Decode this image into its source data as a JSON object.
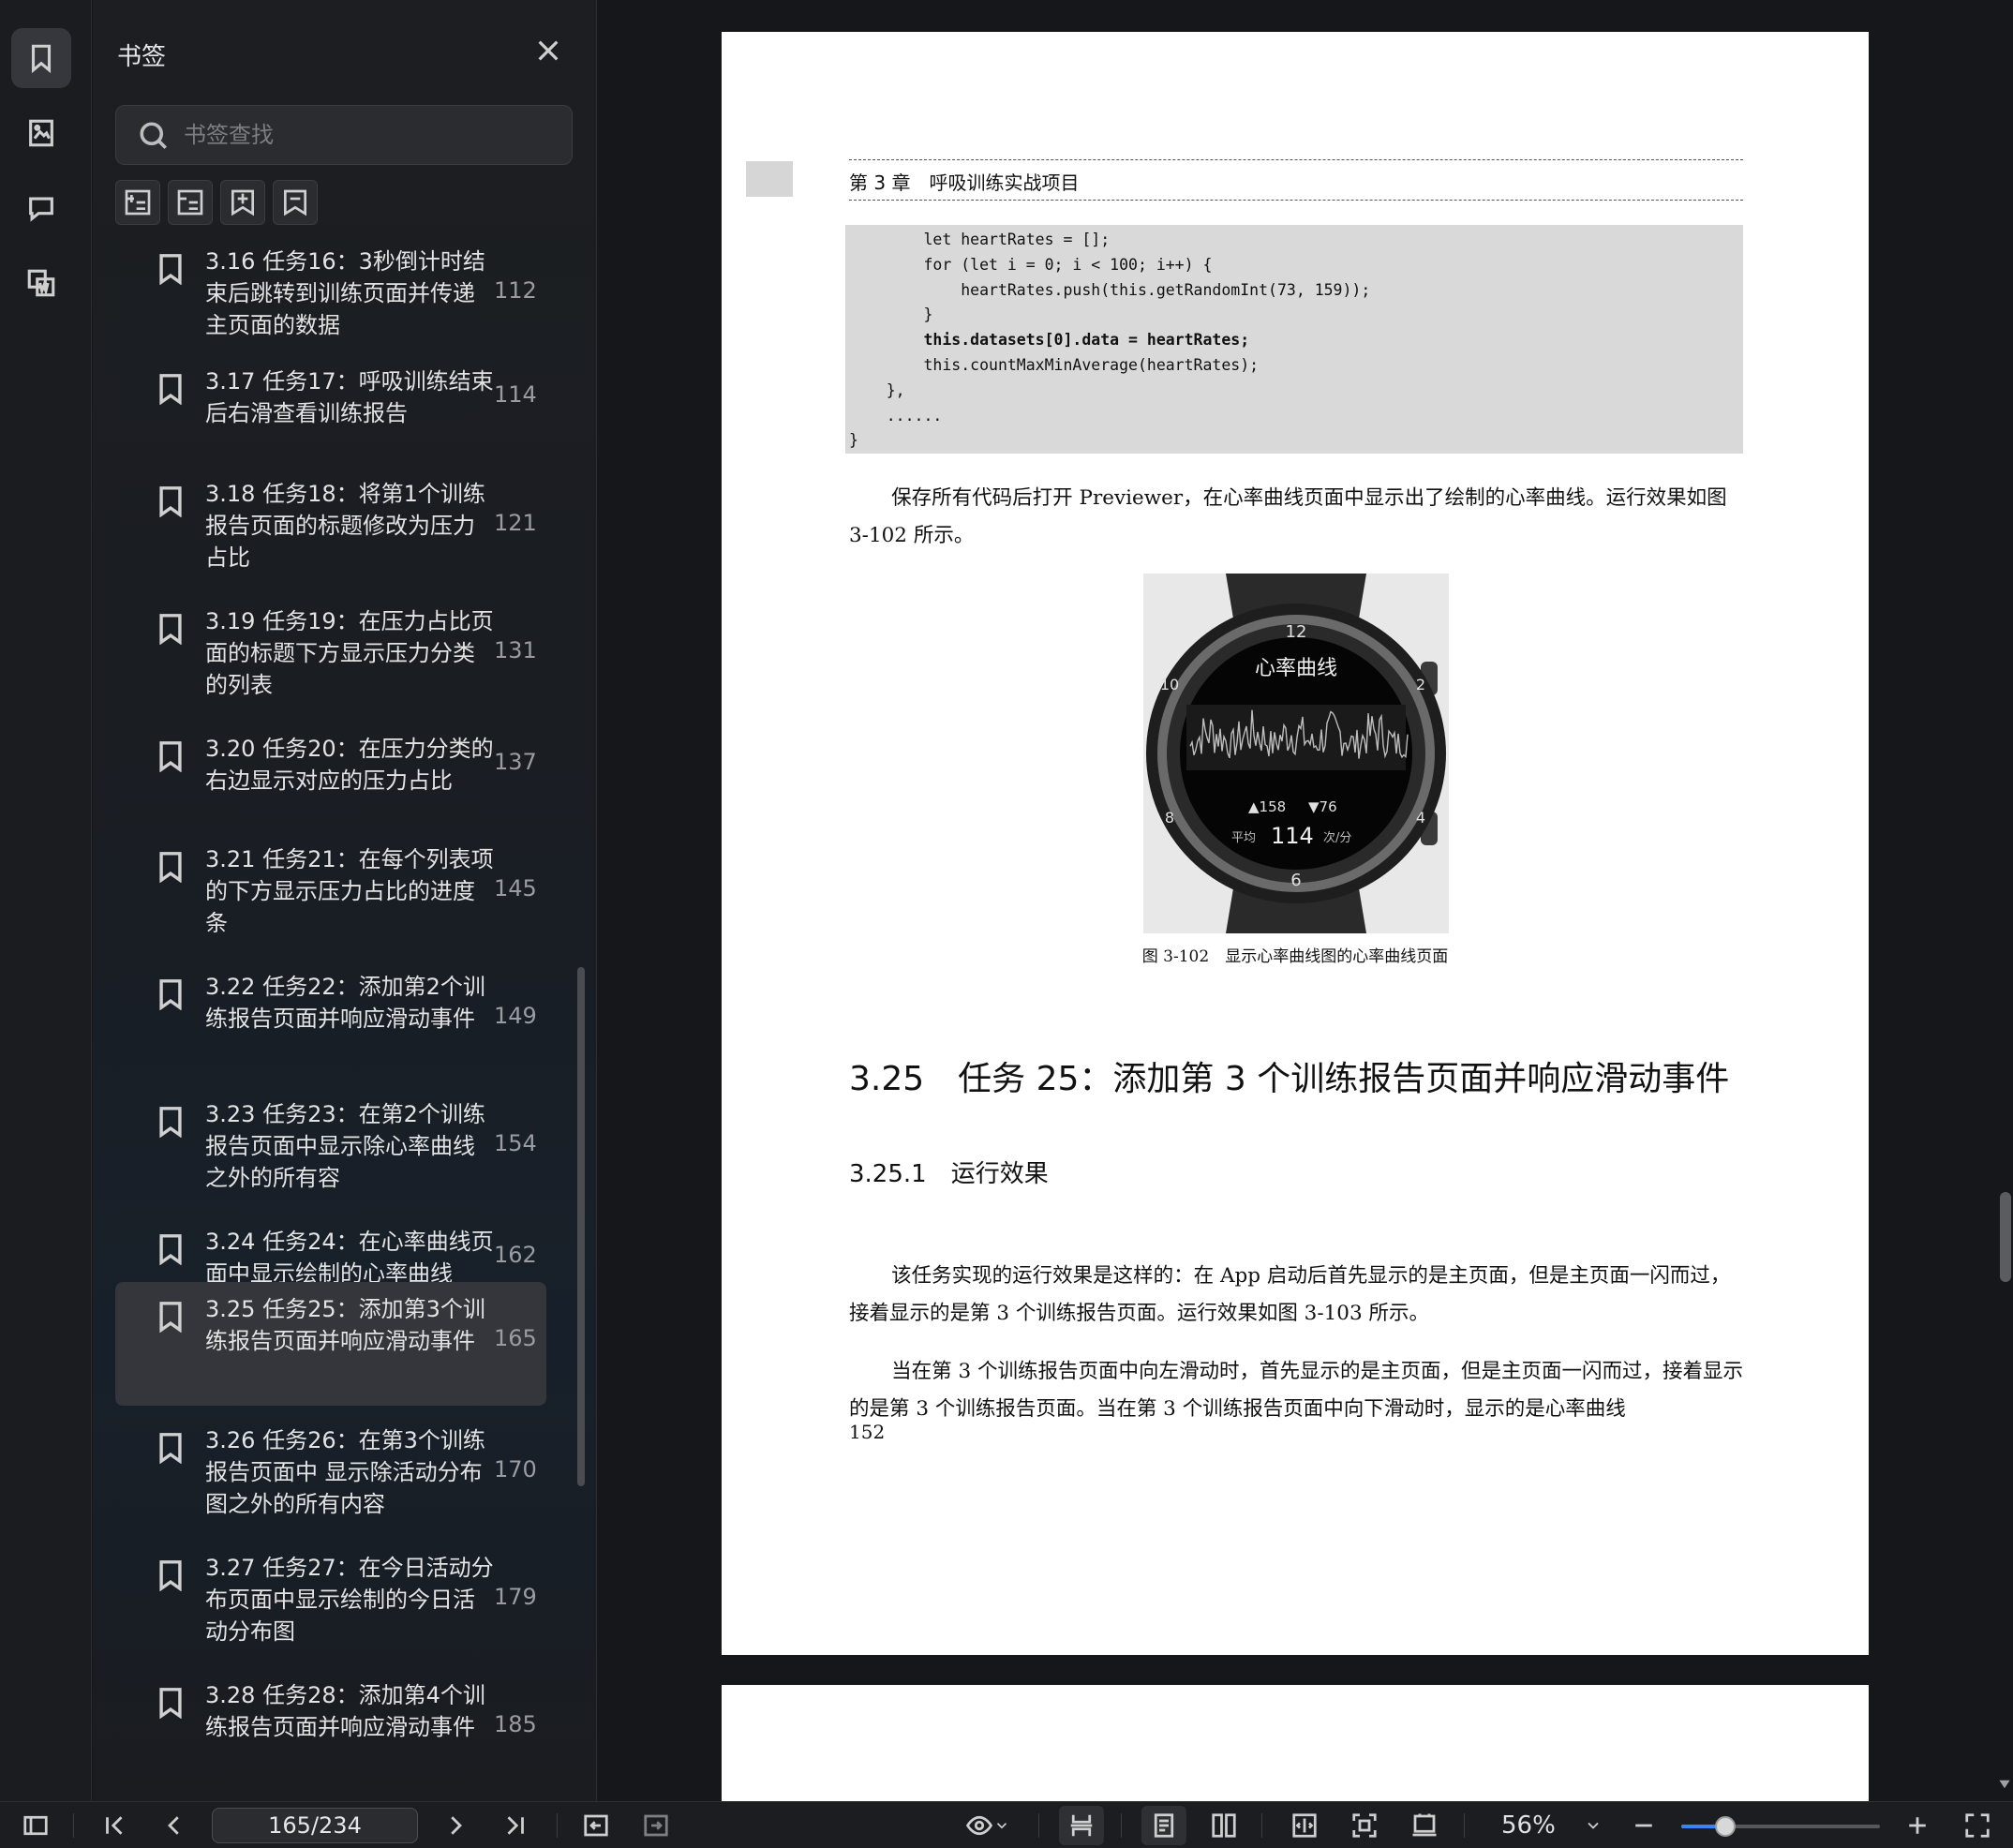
{
  "panel": {
    "title": "书签",
    "search_placeholder": "书签查找"
  },
  "bookmarks": [
    {
      "label": "3.16 任务16：3秒倒计时结束后跳转到训练页面并传递主页面的数据",
      "page": "112"
    },
    {
      "label": "3.17 任务17：呼吸训练结束后右滑查看训练报告",
      "page": "114"
    },
    {
      "label": "3.18 任务18：将第1个训练报告页面的标题修改为压力占比",
      "page": "121"
    },
    {
      "label": "3.19 任务19：在压力占比页面的标题下方显示压力分类的列表",
      "page": "131"
    },
    {
      "label": "3.20 任务20：在压力分类的右边显示对应的压力占比",
      "page": "137"
    },
    {
      "label": "3.21 任务21：在每个列表项的下方显示压力占比的进度条",
      "page": "145"
    },
    {
      "label": "3.22 任务22：添加第2个训练报告页面并响应滑动事件",
      "page": "149"
    },
    {
      "label": "3.23 任务23：在第2个训练报告页面中显示除心率曲线之外的所有容",
      "page": "154"
    },
    {
      "label": "3.24 任务24：在心率曲线页面中显示绘制的心率曲线",
      "page": "162"
    },
    {
      "label": "3.25 任务25：添加第3个训练报告页面并响应滑动事件",
      "page": "165"
    },
    {
      "label": "3.26 任务26：在第3个训练报告页面中 显示除活动分布图之外的所有内容",
      "page": "170"
    },
    {
      "label": "3.27 任务27：在今日活动分布页面中显示绘制的今日活动分布图",
      "page": "179"
    },
    {
      "label": "3.28 任务28：添加第4个训练报告页面并响应滑动事件",
      "page": "185"
    }
  ],
  "selected_bookmark": "3.25 任务25：添加第3个训练报告页面并响应滑动事件",
  "document": {
    "running_head": "第 3 章　呼吸训练实战项目",
    "code_lines": [
      "        let heartRates = [];",
      "        for (let i = 0; i < 100; i++) {",
      "            heartRates.push(this.getRandomInt(73, 159));",
      "        }",
      "        this.datasets[0].data = heartRates;",
      "        this.countMaxMinAverage(heartRates);",
      "    },",
      "    ......",
      "}"
    ],
    "para1": "保存所有代码后打开 Previewer，在心率曲线页面中显示出了绘制的心率曲线。运行效果如图 3-102 所示。",
    "figure": {
      "watch_title": "心率曲线",
      "max_label": "▲158",
      "min_label": "▼76",
      "avg_prefix": "平均",
      "avg_value": "114",
      "avg_unit": "次/分",
      "bezel_12": "12",
      "bezel_6": "6",
      "bezel_8": "8",
      "bezel_10": "10",
      "bezel_2": "2",
      "bezel_4": "4",
      "caption": "图 3-102　显示心率曲线图的心率曲线页面"
    },
    "section_heading": "3.25　任务 25：添加第 3 个训练报告页面并响应滑动事件",
    "subsection_heading": "3.25.1　运行效果",
    "para2": "该任务实现的运行效果是这样的：在 App 启动后首先显示的是主页面，但是主页面一闪而过，接着显示的是第 3 个训练报告页面。运行效果如图 3-103 所示。",
    "para3": "当在第 3 个训练报告页面中向左滑动时，首先显示的是主页面，但是主页面一闪而过，接着显示的是第 3 个训练报告页面。当在第 3 个训练报告页面中向下滑动时，显示的是心率曲线",
    "page_number": "152"
  },
  "toolbar": {
    "page_indicator": "165/234",
    "zoom": "56%",
    "zoom_level": 0.22
  },
  "colors": {
    "accent": "#3b82f6",
    "panel_bg": "#1c1e21",
    "selected_bg": "#34363b"
  }
}
